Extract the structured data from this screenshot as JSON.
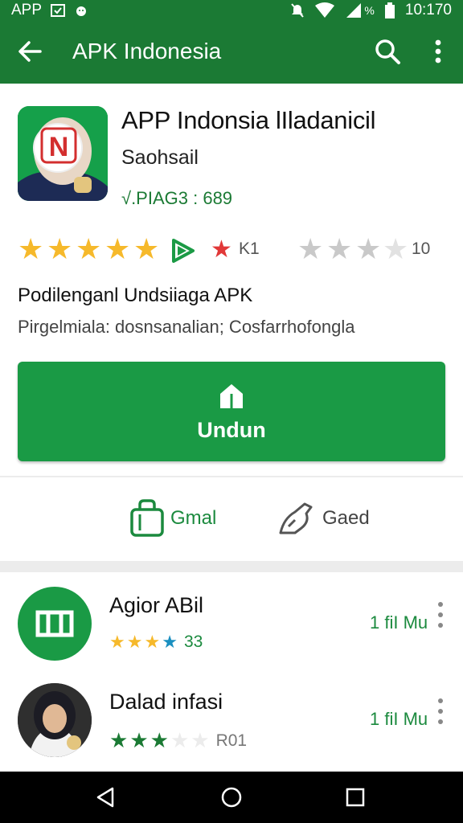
{
  "status_bar": {
    "left_text": "APP",
    "battery_percent_glyph": "%",
    "time": "10:170"
  },
  "app_bar": {
    "title": "APK Indonesia",
    "back_icon": "arrow-left-icon",
    "search_icon": "search-icon",
    "more_icon": "more-vert-icon"
  },
  "app": {
    "icon_letter": "N",
    "title": "APP Indonsia lIladanicil",
    "developer": "Saohsail",
    "version": "√.PIAG3 : 689",
    "rating": {
      "stars_filled": 5,
      "count_a": "K1",
      "stars_gray": 4,
      "count_b": "10"
    },
    "description_heading": "Podilenganl Undsiiaga APK",
    "description_sub": "Pirgelmiala: dosnsanalian; Cosfarrhofongla"
  },
  "download": {
    "label": "Undun"
  },
  "actions": {
    "gmail_label": "Gmal",
    "gaed_label": "Gaed"
  },
  "list": [
    {
      "name": "Agior ABil",
      "rating_value": 3.5,
      "rating_label": "33",
      "size": "1 fiI Mu"
    },
    {
      "name": "Dalad infasi",
      "rating_value": 2.5,
      "rating_label": "R01",
      "size": "1 fiI Mu"
    }
  ],
  "colors": {
    "app_bar": "#1b7a34",
    "primary_button": "#1a9a45",
    "star_gold": "#f6b92b",
    "star_green": "#1b7a34",
    "star_gray": "#c9c9c9"
  }
}
